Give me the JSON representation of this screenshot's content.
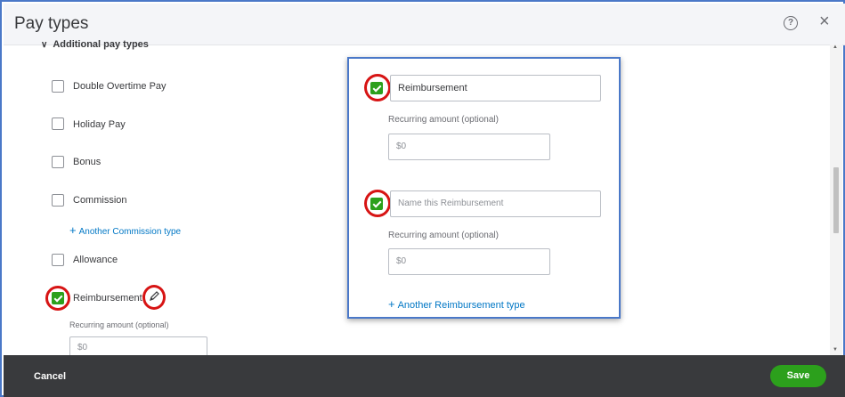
{
  "window": {
    "title": "Pay types"
  },
  "section": {
    "title": "Additional pay types"
  },
  "pay_types": [
    {
      "label": "Double Overtime Pay",
      "checked": false
    },
    {
      "label": "Holiday Pay",
      "checked": false
    },
    {
      "label": "Bonus",
      "checked": false
    },
    {
      "label": "Commission",
      "checked": false
    },
    {
      "label": "Allowance",
      "checked": false
    },
    {
      "label": "Reimbursement",
      "checked": true
    }
  ],
  "commission_link": "Another Commission type",
  "reimbursement": {
    "recurring_label": "Recurring amount (optional)",
    "amount_placeholder": "$0"
  },
  "popup": {
    "row1": {
      "name_value": "Reimbursement",
      "recurring_label": "Recurring amount (optional)",
      "amount_placeholder": "$0"
    },
    "row2": {
      "name_placeholder": "Name this Reimbursement",
      "recurring_label": "Recurring amount (optional)",
      "amount_placeholder": "$0"
    },
    "add_link": "Another Reimbursement type"
  },
  "footer": {
    "cancel_label": "Cancel",
    "save_label": "Save"
  },
  "colors": {
    "accent": "#2ca01c",
    "link": "#0077c5",
    "highlight_ring": "#d71414",
    "footer_bg": "#393a3d"
  }
}
